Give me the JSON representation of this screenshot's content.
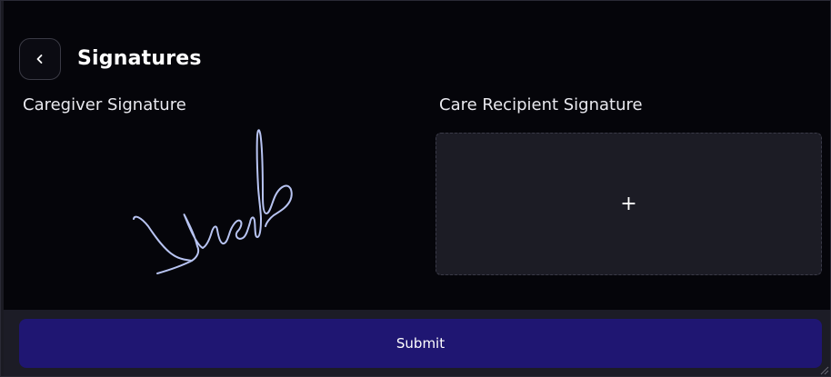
{
  "header": {
    "back_icon": "chevron-left-icon",
    "title": "Signatures"
  },
  "caregiver": {
    "label": "Caregiver Signature",
    "signature_state": "signed"
  },
  "recipient": {
    "label": "Care Recipient Signature",
    "add_icon": "+"
  },
  "footer": {
    "submit_label": "Submit"
  },
  "colors": {
    "background": "#05050a",
    "signature_ink": "#b8c4f2",
    "submit_bg": "#1f1672",
    "recipient_box_bg": "#1c1c25"
  }
}
